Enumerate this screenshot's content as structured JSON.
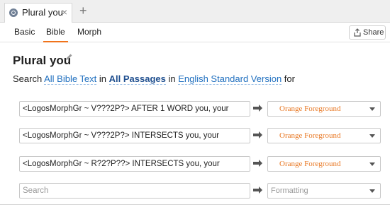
{
  "tab": {
    "title": "Plural you",
    "close": "×",
    "new_tab": "+"
  },
  "subnav": {
    "tabs": [
      {
        "label": "Basic"
      },
      {
        "label": "Bible"
      },
      {
        "label": "Morph"
      }
    ],
    "active": "Bible",
    "share_label": "Share"
  },
  "document": {
    "title": "Plural you"
  },
  "search_line": {
    "prefix": "Search ",
    "scope_link": "All Bible Text",
    "in1": " in ",
    "passages_link": "All Passages",
    "in2": " in ",
    "version_link": "English Standard Version",
    "suffix": " for"
  },
  "rows": [
    {
      "query": "<LogosMorphGr ~ V???2P?> AFTER 1 WORD you, your",
      "format": "Orange Foreground"
    },
    {
      "query": " <LogosMorphGr ~ V???2P?> INTERSECTS you, your",
      "format": "Orange Foreground"
    },
    {
      "query": "<LogosMorphGr ~ R?2?P??> INTERSECTS you, your",
      "format": "Orange Foreground"
    }
  ],
  "empty_row": {
    "query_placeholder": "Search",
    "format_placeholder": "Formatting"
  },
  "icons": {
    "tab": "globe-icon",
    "edit": "pencil-icon",
    "share": "share-icon",
    "arrow": "arrow-right-icon",
    "caret": "chevron-down-icon"
  },
  "colors": {
    "accent": "#f0731b",
    "link": "#1f6fbf",
    "format_text": "#e87722"
  }
}
